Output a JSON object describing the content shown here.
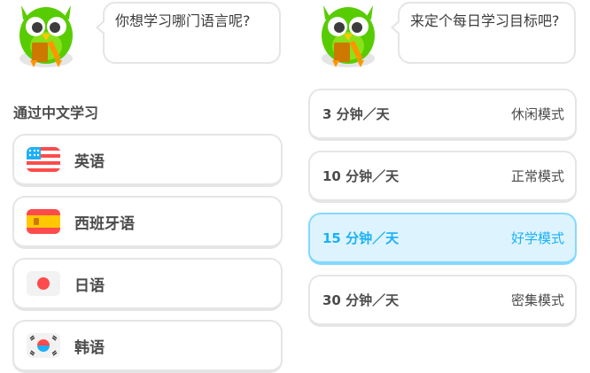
{
  "left": {
    "prompt": "你想学习哪门语言呢?",
    "section_title": "通过中文学习",
    "languages": [
      {
        "label": "英语",
        "flag": "us-flag-icon"
      },
      {
        "label": "西班牙语",
        "flag": "spain-flag-icon"
      },
      {
        "label": "日语",
        "flag": "japan-flag-icon"
      },
      {
        "label": "韩语",
        "flag": "korea-flag-icon"
      }
    ]
  },
  "right": {
    "prompt": "来定个每日学习目标吧?",
    "goals": [
      {
        "minutes": "3 分钟／天",
        "mode": "休闲模式",
        "selected": false
      },
      {
        "minutes": "10 分钟／天",
        "mode": "正常模式",
        "selected": false
      },
      {
        "minutes": "15 分钟／天",
        "mode": "好学模式",
        "selected": true
      },
      {
        "minutes": "30 分钟／天",
        "mode": "密集模式",
        "selected": false
      }
    ]
  },
  "colors": {
    "owl_green": "#58cc02",
    "selected_bg": "#ddf4ff",
    "selected_border": "#84d8ff",
    "selected_text": "#1cb0f6",
    "card_border": "#e5e5e5"
  }
}
